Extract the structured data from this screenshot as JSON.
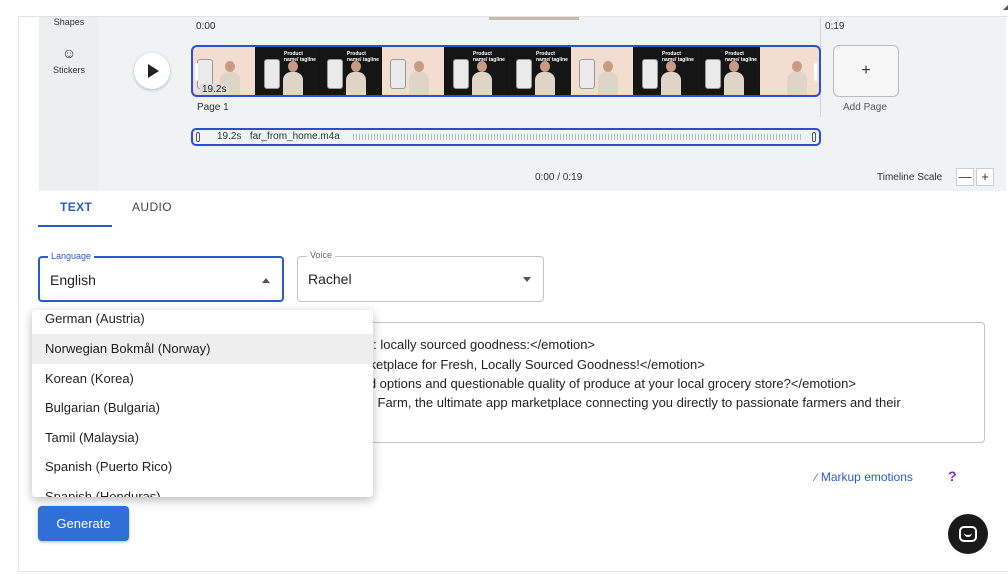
{
  "left_rail": {
    "shapes_label": "Shapes",
    "stickers_label": "Stickers",
    "stickers_icon": "smile-icon"
  },
  "timeline": {
    "time_start": "0:00",
    "time_end": "0:19",
    "clip_duration": "19.2s",
    "page_label": "Page 1",
    "add_page_symbol": "+",
    "add_page_label": "Add Page",
    "audio_duration": "19.2s",
    "audio_file": "far_from_home.m4a",
    "playback_time": "0:00 / 0:19",
    "scale_label": "Timeline Scale",
    "scale_minus": "—",
    "scale_plus": "+",
    "thumb_caption": "Product name/ tagline"
  },
  "tabs": {
    "text": "TEXT",
    "audio": "AUDIO"
  },
  "language": {
    "label": "Language",
    "value": "English"
  },
  "voice": {
    "label": "Voice",
    "value": "Rachel"
  },
  "script_lines": [
    "rm: locally sourced goodness:</emotion>",
    "arketplace for Fresh, Locally Sourced Goodness!</emotion>",
    "ted options and questionable quality of produce at your local grocery store?</emotion>",
    "l Farm, the ultimate app marketplace connecting you directly to passionate farmers and their"
  ],
  "language_options": [
    "German (Austria)",
    "Norwegian Bokmål (Norway)",
    "Korean (Korea)",
    "Bulgarian (Bulgaria)",
    "Tamil (Malaysia)",
    "Spanish (Puerto Rico)",
    "Spanish (Honduras)"
  ],
  "markup_emotions": "Markup emotions",
  "help": "?",
  "generate": "Generate",
  "colors": {
    "accent": "#2a5bc7",
    "track_border": "#2b4fd4",
    "generate_bg": "#2f6fd6",
    "help": "#7b2fbe"
  }
}
